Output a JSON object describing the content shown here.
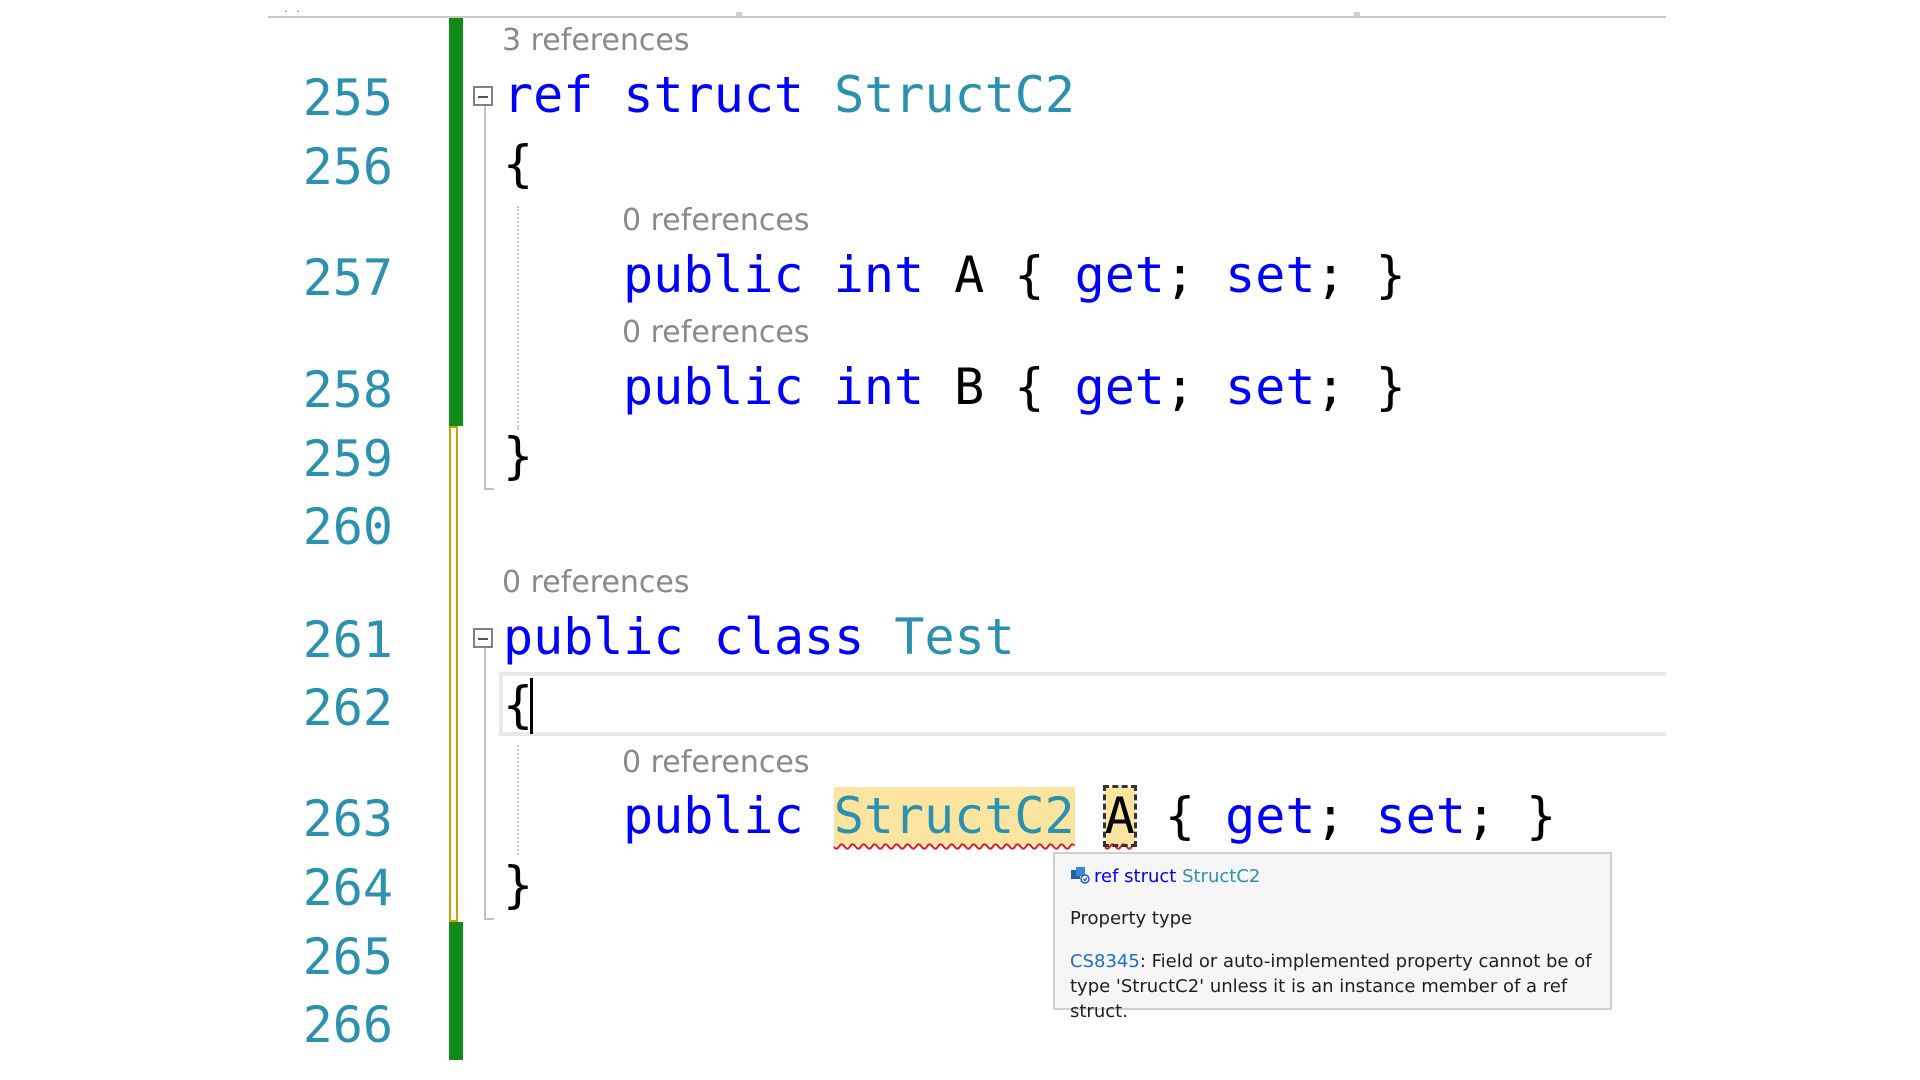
{
  "editor": {
    "line_numbers": [
      "255",
      "256",
      "257",
      "258",
      "259",
      "260",
      "261",
      "262",
      "263",
      "264",
      "265",
      "266"
    ],
    "code_lens": {
      "struct_c2": "3 references",
      "prop_a": "0 references",
      "prop_b": "0 references",
      "class_test": "0 references",
      "prop_struct": "0 references"
    },
    "code": {
      "l255_kw_ref": "ref",
      "l255_kw_struct": "struct",
      "l255_type": "StructC2",
      "l256_brace": "{",
      "l257_kw_public": "public",
      "l257_kw_int": "int",
      "l257_name": "A",
      "l257_open": "{",
      "l257_get": "get",
      "l257_semi1": ";",
      "l257_set": "set",
      "l257_semi2": ";",
      "l257_close": "}",
      "l258_kw_public": "public",
      "l258_kw_int": "int",
      "l258_name": "B",
      "l258_open": "{",
      "l258_get": "get",
      "l258_semi1": ";",
      "l258_set": "set",
      "l258_semi2": ";",
      "l258_close": "}",
      "l259_brace": "}",
      "l261_kw_public": "public",
      "l261_kw_class": "class",
      "l261_type": "Test",
      "l262_brace": "{",
      "l263_kw_public": "public",
      "l263_type": "StructC2",
      "l263_name": "A",
      "l263_open": "{",
      "l263_get": "get",
      "l263_semi1": ";",
      "l263_set": "set",
      "l263_semi2": ";",
      "l263_close": "}",
      "l264_brace": "}"
    }
  },
  "quick_info": {
    "icon": "struct-icon",
    "signature_kw": "ref struct",
    "signature_type": "StructC2",
    "description": "Property type",
    "error_code": "CS8345",
    "error_text": ": Field or auto-implemented property cannot be of type 'StructC2' unless it is an instance member of a ref struct."
  },
  "colors": {
    "keyword": "#0000ff",
    "type": "#2b91af",
    "line_number": "#2b91af",
    "change_saved": "#108a18",
    "change_unsaved": "#c8a200",
    "highlight": "#fbe3a0",
    "error_squiggle": "#e21b1b"
  }
}
